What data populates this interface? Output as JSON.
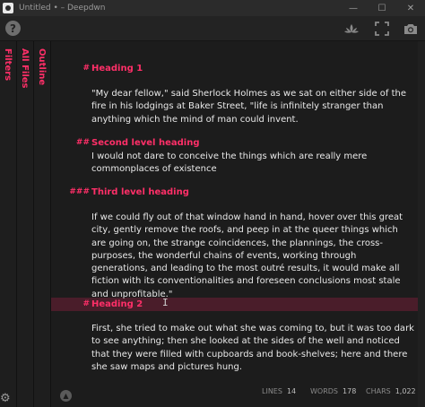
{
  "window": {
    "title": "Untitled • – Deepdwn",
    "controls": {
      "minimize": "—",
      "maximize": "☐",
      "close": "✕"
    }
  },
  "toolbar": {
    "help": "?",
    "icons": [
      "lotus-icon",
      "fullscreen-icon",
      "camera-icon"
    ]
  },
  "sidebar": {
    "tabs": [
      {
        "label": "Filters"
      },
      {
        "label": "All Files"
      },
      {
        "label": "Outline"
      }
    ]
  },
  "document": {
    "blocks": [
      {
        "marker": "#",
        "heading": "Heading 1",
        "text": "\"My dear fellow,\" said Sherlock Holmes as we sat on either side of the fire in his lodgings at Baker Street, \"life is infinitely stranger than anything which the mind of man could invent."
      },
      {
        "marker": "##",
        "heading": "Second level heading",
        "text": "I would not dare to conceive the things which are really mere commonplaces of existence"
      },
      {
        "marker": "###",
        "heading": "Third level heading",
        "text": "If we could fly out of that window hand in hand, hover over this great city, gently remove the roofs, and peep in at the queer things which are going on, the strange coincidences, the plannings, the cross-purposes, the wonderful chains of events, working through generations, and leading to the most outré results, it would make all fiction with its conventionalities and foreseen conclusions most stale and unprofitable.\""
      },
      {
        "marker": "#",
        "heading": "Heading 2",
        "text": "First, she tried to make out what she was coming to, but it was too dark to see anything; then she looked at the sides of the well and noticed that they were filled with cupboards and book-shelves; here and there she saw maps and pictures hung."
      }
    ]
  },
  "status": {
    "lines_label": "LINES",
    "lines": "14",
    "words_label": "WORDS",
    "words": "178",
    "chars_label": "CHARS",
    "chars": "1,022"
  },
  "colors": {
    "accent": "#ff2f68",
    "active_line": "#4a1d2a",
    "background": "#1c1c1c"
  }
}
